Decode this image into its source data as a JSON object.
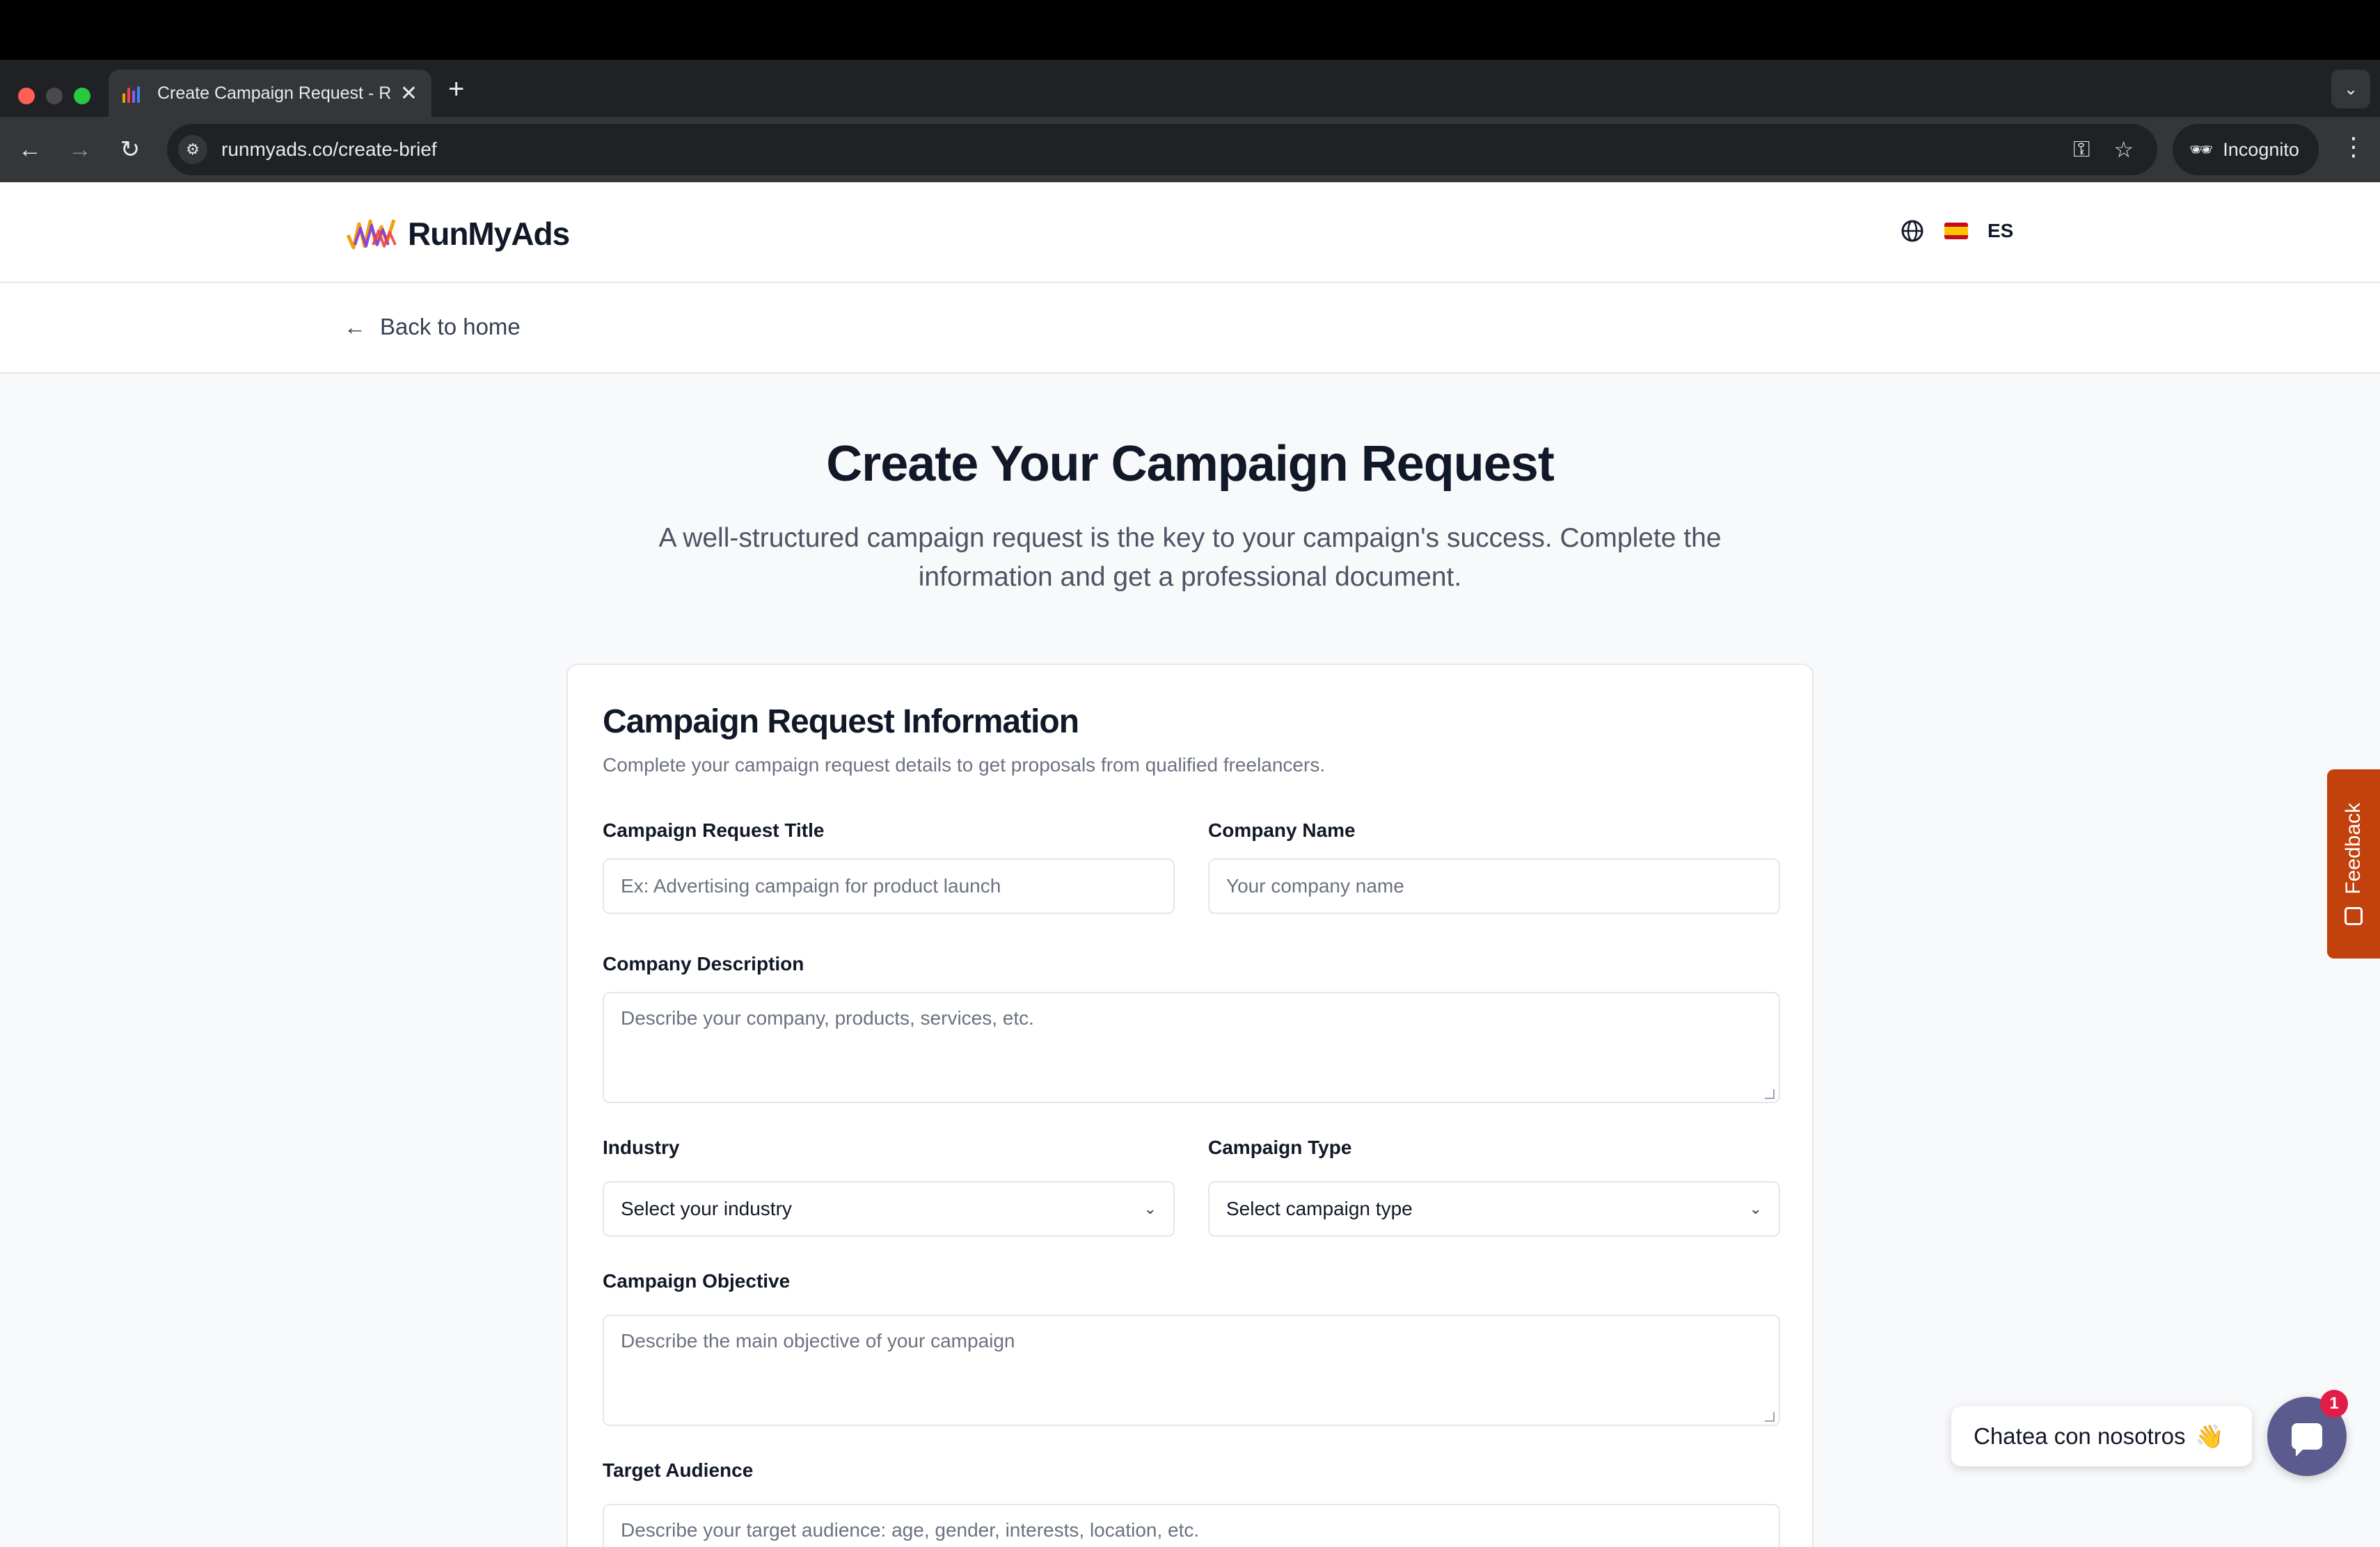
{
  "browser": {
    "tab_title": "Create Campaign Request - R",
    "new_tab": "+",
    "url": "runmyads.co/create-brief",
    "incognito_label": "Incognito"
  },
  "site": {
    "brand": "RunMyAds",
    "language_code": "ES",
    "back_link": "Back to home"
  },
  "hero": {
    "title": "Create Your Campaign Request",
    "subtitle": "A well-structured campaign request is the key to your campaign's success. Complete the information and get a professional document."
  },
  "form": {
    "title": "Campaign Request Information",
    "subtitle": "Complete your campaign request details to get proposals from qualified freelancers.",
    "fields": {
      "request_title": {
        "label": "Campaign Request Title",
        "placeholder": "Ex: Advertising campaign for product launch"
      },
      "company_name": {
        "label": "Company Name",
        "placeholder": "Your company name"
      },
      "company_description": {
        "label": "Company Description",
        "placeholder": "Describe your company, products, services, etc."
      },
      "industry": {
        "label": "Industry",
        "value": "Select your industry"
      },
      "campaign_type": {
        "label": "Campaign Type",
        "value": "Select campaign type"
      },
      "objective": {
        "label": "Campaign Objective",
        "placeholder": "Describe the main objective of your campaign"
      },
      "audience": {
        "label": "Target Audience",
        "placeholder": "Describe your target audience: age, gender, interests, location, etc."
      }
    }
  },
  "widgets": {
    "feedback": "Feedback",
    "chat_prompt": "Chatea con nosotros",
    "chat_emoji": "👋",
    "chat_badge": "1"
  },
  "colors": {
    "accent_feedback": "#c2410c",
    "chat_button": "#5b5b8f",
    "badge": "#e11d48"
  }
}
